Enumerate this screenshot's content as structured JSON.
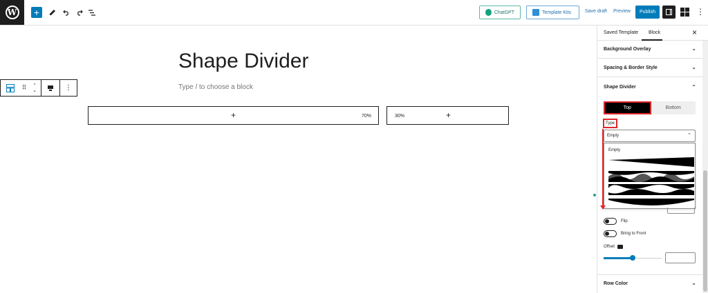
{
  "topbar": {
    "wp_logo_letter": "W",
    "add_symbol": "+",
    "chatgpt_label": "ChatGPT",
    "template_kits_label": "Template Kits",
    "save_draft_label": "Save draft",
    "preview_label": "Preview",
    "publish_label": "Publish",
    "icons": [
      "wordpress-logo",
      "add-block-icon",
      "edit-pen-icon",
      "undo-icon",
      "redo-icon",
      "list-view-icon",
      "settings-panel-icon",
      "elementor-icon",
      "more-options-icon"
    ]
  },
  "canvas": {
    "title": "Shape Divider",
    "placeholder": "Type / to choose a block",
    "columns": [
      {
        "plus": "+",
        "percent": "70%"
      },
      {
        "plus": "+",
        "percent": "30%"
      }
    ]
  },
  "sidebar": {
    "tabs": [
      "Saved Template",
      "Block"
    ],
    "active_tab": "Block",
    "close_symbol": "×",
    "sections": {
      "background_overlay": "Background Overlay",
      "spacing_border": "Spacing & Border Style",
      "shape_divider": "Shape Divider",
      "row_color": "Row Color"
    },
    "position_options": [
      "Top",
      "Bottom"
    ],
    "selected_position": "Top",
    "type_label": "Type",
    "type_value": "Empty",
    "dropdown_options": [
      "Empty",
      "tilt",
      "waves-layered",
      "waves-double",
      "curve"
    ],
    "flip_label": "Flip",
    "bring_front_label": "Bring to Front",
    "offset_label": "Offset",
    "offset_fraction": 0.5,
    "accent_color": "#007cba",
    "highlight_color": "#e0262b"
  }
}
